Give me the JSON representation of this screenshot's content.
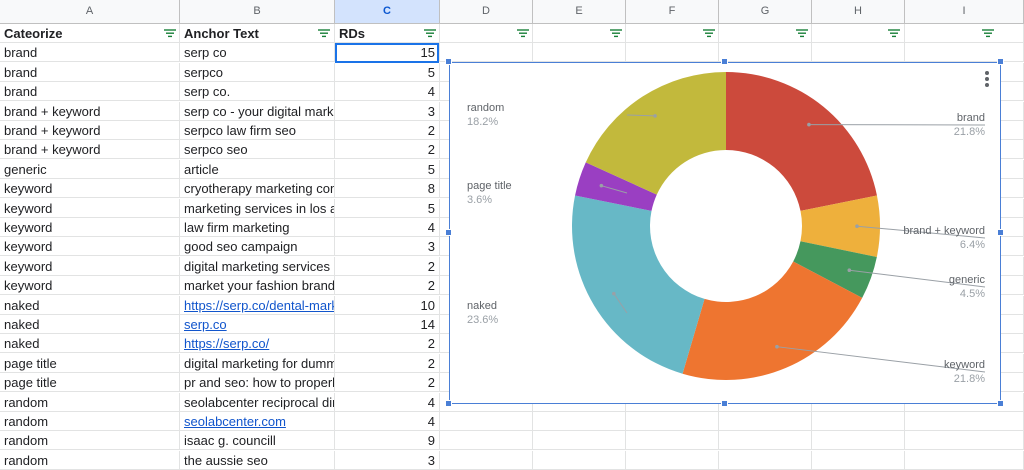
{
  "columns": [
    "A",
    "B",
    "C",
    "D",
    "E",
    "F",
    "G",
    "H",
    "I"
  ],
  "selected_column": "C",
  "header_row": {
    "category": "Cateorize",
    "anchor": "Anchor Text",
    "rds": "RDs"
  },
  "rows": [
    {
      "category": "brand",
      "anchor": "serp co",
      "rds": "15",
      "link": false
    },
    {
      "category": "brand",
      "anchor": "serpco",
      "rds": "5",
      "link": false
    },
    {
      "category": "brand",
      "anchor": "serp co.",
      "rds": "4",
      "link": false
    },
    {
      "category": "brand + keyword",
      "anchor": "serp co - your digital marketing",
      "rds": "3",
      "link": false
    },
    {
      "category": "brand + keyword",
      "anchor": "serpco law firm seo",
      "rds": "2",
      "link": false
    },
    {
      "category": "brand + keyword",
      "anchor": "serpco seo",
      "rds": "2",
      "link": false
    },
    {
      "category": "generic",
      "anchor": "article",
      "rds": "5",
      "link": false
    },
    {
      "category": "keyword",
      "anchor": "cryotherapy marketing company",
      "rds": "8",
      "link": false
    },
    {
      "category": "keyword",
      "anchor": "marketing services in los angeles",
      "rds": "5",
      "link": false
    },
    {
      "category": "keyword",
      "anchor": "law firm marketing",
      "rds": "4",
      "link": false
    },
    {
      "category": "keyword",
      "anchor": "good seo campaign",
      "rds": "3",
      "link": false
    },
    {
      "category": "keyword",
      "anchor": "digital marketing services by",
      "rds": "2",
      "link": false
    },
    {
      "category": "keyword",
      "anchor": "market your fashion brand",
      "rds": "2",
      "link": false
    },
    {
      "category": "naked",
      "anchor": "https://serp.co/dental-marketing",
      "rds": "10",
      "link": true
    },
    {
      "category": "naked",
      "anchor": "serp.co",
      "rds": "14",
      "link": true
    },
    {
      "category": "naked",
      "anchor": "https://serp.co/",
      "rds": "2",
      "link": true
    },
    {
      "category": "page title",
      "anchor": "digital marketing for dummies",
      "rds": "2",
      "link": false
    },
    {
      "category": "page title",
      "anchor": "pr and seo: how to properly use",
      "rds": "2",
      "link": false
    },
    {
      "category": "random",
      "anchor": "seolabcenter reciprocal directory",
      "rds": "4",
      "link": false
    },
    {
      "category": "random",
      "anchor": "seolabcenter.com",
      "rds": "4",
      "link": true
    },
    {
      "category": "random",
      "anchor": "isaac g. councill",
      "rds": "9",
      "link": false
    },
    {
      "category": "random",
      "anchor": "the aussie seo",
      "rds": "3",
      "link": false
    }
  ],
  "colors": {
    "filter": "#188038",
    "selection": "#1a73e8",
    "link": "#1155cc"
  },
  "chart_data": {
    "type": "pie",
    "donut": true,
    "title": "",
    "slices": [
      {
        "label": "brand",
        "value": 21.8,
        "pct": "21.8%",
        "color": "#cc4a3c"
      },
      {
        "label": "brand + keyword",
        "value": 6.4,
        "pct": "6.4%",
        "color": "#eeb03c"
      },
      {
        "label": "generic",
        "value": 4.5,
        "pct": "4.5%",
        "color": "#45985d"
      },
      {
        "label": "keyword",
        "value": 21.8,
        "pct": "21.8%",
        "color": "#ee7530"
      },
      {
        "label": "naked",
        "value": 23.6,
        "pct": "23.6%",
        "color": "#67b8c6"
      },
      {
        "label": "page title",
        "value": 3.6,
        "pct": "3.6%",
        "color": "#9a3fc2"
      },
      {
        "label": "random",
        "value": 18.2,
        "pct": "18.2%",
        "color": "#c2b93c"
      }
    ]
  }
}
